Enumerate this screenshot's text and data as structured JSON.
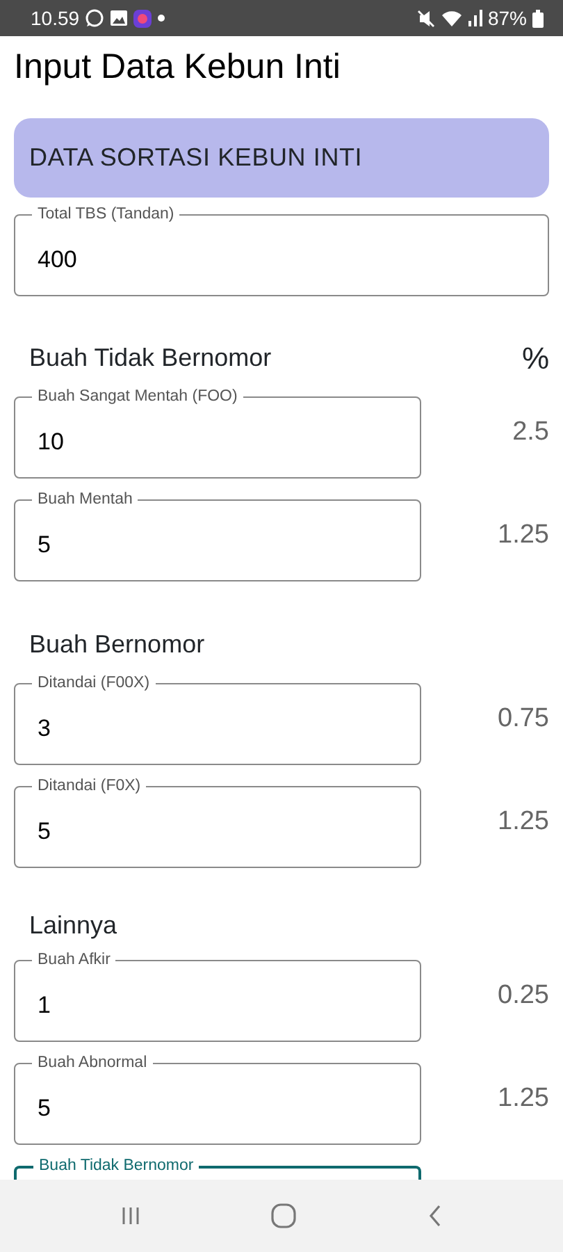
{
  "status_bar": {
    "time": "10.59",
    "battery": "87%"
  },
  "title": "Input Data Kebun Inti",
  "banner": "DATA SORTASI KEBUN INTI",
  "total_field": {
    "label": "Total TBS (Tandan)",
    "value": "400",
    "focused": false
  },
  "sections": [
    {
      "title": "Buah Tidak Bernomor",
      "unit": "%",
      "fields": [
        {
          "label": "Buah Sangat Mentah (FOO)",
          "value": "10",
          "percent": "2.5",
          "focused": false
        },
        {
          "label": "Buah Mentah",
          "value": "5",
          "percent": "1.25",
          "focused": false
        }
      ]
    },
    {
      "title": "Buah Bernomor",
      "fields": [
        {
          "label": "Ditandai (F00X)",
          "value": "3",
          "percent": "0.75",
          "focused": false
        },
        {
          "label": "Ditandai (F0X)",
          "value": "5",
          "percent": "1.25",
          "focused": false
        }
      ]
    },
    {
      "title": "Lainnya",
      "fields": [
        {
          "label": "Buah Afkir",
          "value": "1",
          "percent": "0.25",
          "focused": false
        },
        {
          "label": "Buah Abnormal",
          "value": "5",
          "percent": "1.25",
          "focused": false
        },
        {
          "label": "Buah Tidak Bernomor",
          "focused": true
        }
      ]
    }
  ]
}
